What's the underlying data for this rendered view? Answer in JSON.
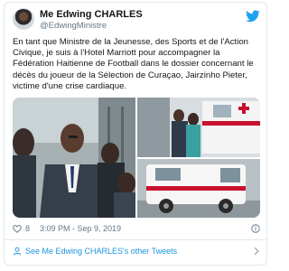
{
  "tweet": {
    "author_name": "Me Edwing CHARLES",
    "author_handle": "@EdwingMinistre",
    "text": "En tant que Ministre de la Jeunesse, des Sports et de l'Action Civique, je suis à l'Hotel Marriott pour accompagner la Fédération Haitienne de Football dans le dossier concernant le décès du joueur de la Sélection de Curaçao, Jairzinho Pieter, victime d'une crise cardiaque.",
    "likes": "8",
    "timestamp": "3:09 PM - Sep 9, 2019"
  },
  "footer": {
    "link_text": "See Me Edwing CHARLES's other Tweets"
  },
  "colors": {
    "link": "#1b95e0",
    "muted": "#657786",
    "text": "#14171a",
    "border": "#e1e8ed"
  },
  "icons": [
    "avatar",
    "twitter-bird-icon",
    "heart-icon",
    "info-icon",
    "person-icon",
    "chevron-right-icon"
  ]
}
